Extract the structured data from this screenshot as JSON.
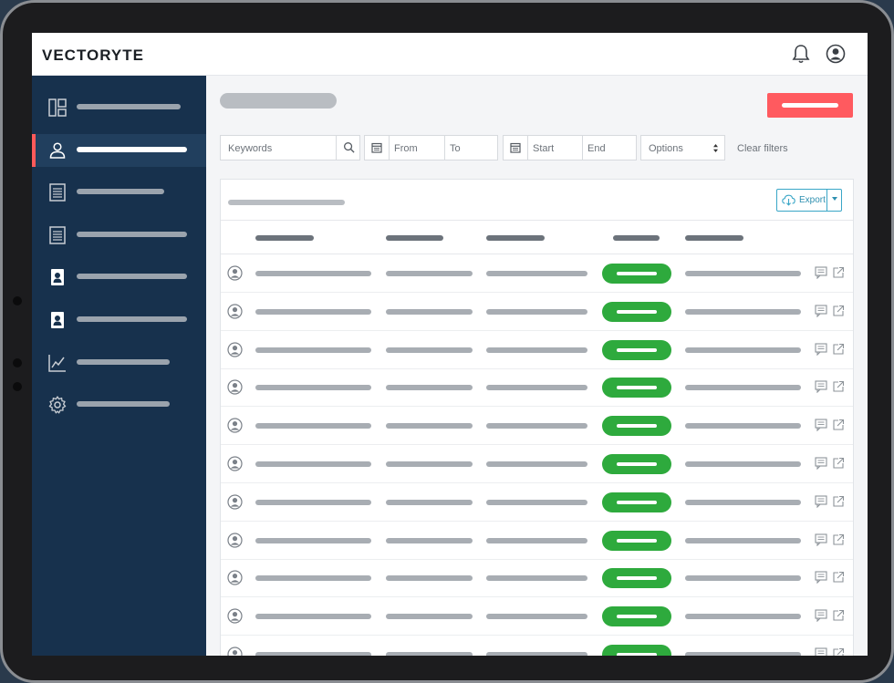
{
  "app": {
    "brand": "VECTORYTE"
  },
  "filters": {
    "keywords_placeholder": "Keywords",
    "from_placeholder": "From",
    "to_placeholder": "To",
    "start_placeholder": "Start",
    "end_placeholder": "End",
    "options_label": "Options",
    "clear_label": "Clear filters"
  },
  "table": {
    "export_label": "Export"
  },
  "colors": {
    "sidebar": "#17314d",
    "accent": "#ff5a5f",
    "status_green": "#2eaa3d",
    "export_blue": "#39a6c7"
  },
  "icons": {
    "sidebar": [
      "dashboard-icon",
      "user-icon",
      "document-icon",
      "document-icon",
      "contact-card-icon",
      "contact-card-icon",
      "chart-line-icon",
      "gear-icon"
    ],
    "header": [
      "bell-icon",
      "user-circle-icon"
    ]
  }
}
